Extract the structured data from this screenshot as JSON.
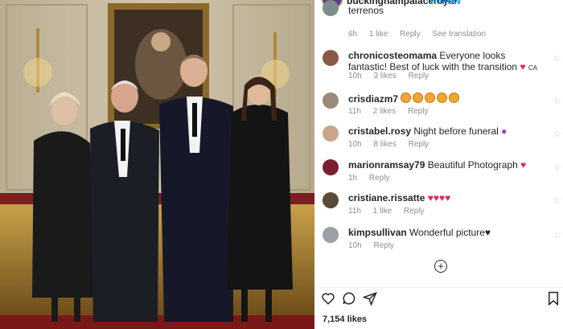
{
  "post": {
    "username": "buckinghampalaceroyal",
    "follow_label": "Follow",
    "likes": "7,154 likes"
  },
  "first_comment": {
    "text": "terrenos",
    "time": "6h",
    "likes": "1 like",
    "reply": "Reply",
    "translation": "See translation"
  },
  "comments": [
    {
      "user": "chronicosteomama",
      "text": "Everyone looks fantastic! Best of luck with the transition",
      "flag": "CA",
      "time": "10h",
      "likes": "3 likes",
      "reply": "Reply"
    },
    {
      "user": "crisdiazm7",
      "text": "",
      "time": "11h",
      "likes": "2 likes",
      "reply": "Reply"
    },
    {
      "user": "cristabel.rosy",
      "text": "Night before funeral",
      "time": "10h",
      "likes": "8 likes",
      "reply": "Reply"
    },
    {
      "user": "marionramsay79",
      "text": "Beautiful Photograph",
      "time": "1h",
      "likes": "",
      "reply": "Reply"
    },
    {
      "user": "cristiane.rissatte",
      "text": "",
      "time": "11h",
      "likes": "1 like",
      "reply": "Reply"
    },
    {
      "user": "kimpsullivan",
      "text": "Wonderful picture♥",
      "time": "10h",
      "likes": "",
      "reply": "Reply"
    }
  ],
  "icons": [
    "heart-icon",
    "comment-icon",
    "share-icon",
    "bookmark-icon",
    "add-comment-icon"
  ],
  "colors": {
    "accent": "#0095f6",
    "heart": "#e0245e",
    "muted": "#8e8e8e"
  }
}
